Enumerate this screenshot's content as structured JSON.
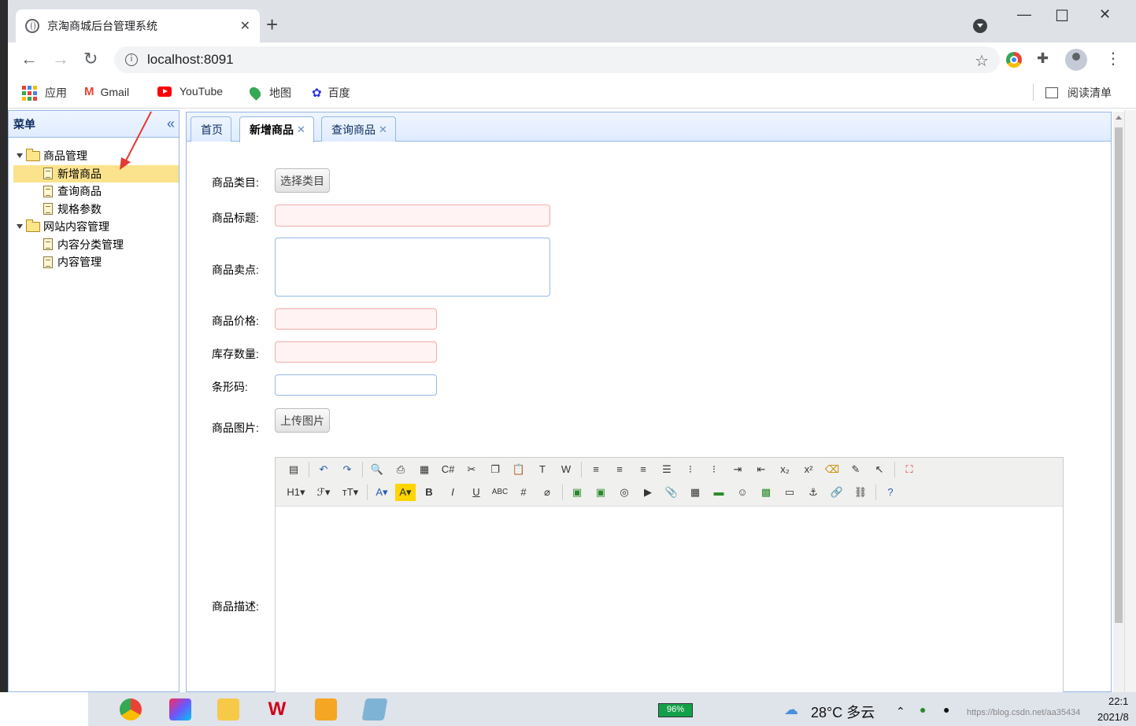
{
  "browser": {
    "tab_title": "京淘商城后台管理系统",
    "url": "localhost:8091",
    "bookmarks": [
      "应用",
      "Gmail",
      "YouTube",
      "地图",
      "百度"
    ],
    "reading_list": "阅读清单"
  },
  "sidebar": {
    "title": "菜单",
    "groups": [
      {
        "label": "商品管理",
        "items": [
          "新增商品",
          "查询商品",
          "规格参数"
        ]
      },
      {
        "label": "网站内容管理",
        "items": [
          "内容分类管理",
          "内容管理"
        ]
      }
    ],
    "selected": "新增商品"
  },
  "tabs": [
    "首页",
    "新增商品",
    "查询商品"
  ],
  "form": {
    "category_label": "商品类目:",
    "category_button": "选择类目",
    "title_label": "商品标题:",
    "sell_point_label": "商品卖点:",
    "price_label": "商品价格:",
    "stock_label": "库存数量:",
    "barcode_label": "条形码:",
    "image_label": "商品图片:",
    "upload_button": "上传图片",
    "desc_label": "商品描述:"
  },
  "taskbar": {
    "battery": "96%",
    "weather": "28°C  多云",
    "time": "22:1",
    "date": "2021/8",
    "watermark": "https://blog.csdn.net/aa35434"
  },
  "colors": {
    "panel_border": "#95b8e7",
    "selected_node": "#fbe38d",
    "invalid_field": "#fff3f3"
  }
}
